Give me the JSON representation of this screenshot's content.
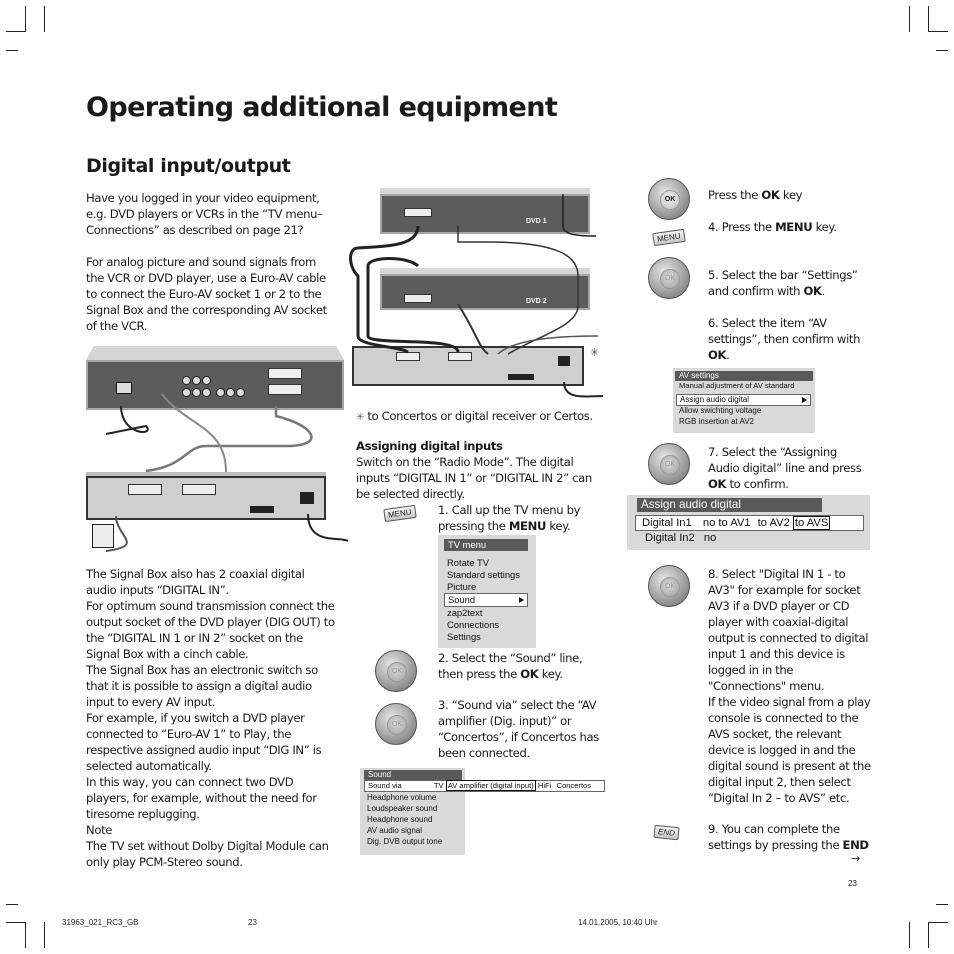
{
  "page": {
    "title": "Operating additional equipment",
    "section_title": "Digital input/output",
    "page_number": "23"
  },
  "left_column": {
    "intro_paragraph": "Have you logged in your video equipment, e.g. DVD players or VCRs in the “TV menu– Connections” as described on page 21?",
    "analog_paragraph": "For analog picture and sound signals from the VCR or DVD player, use a Euro-AV cable to connect the Euro-AV socket 1 or 2 to the Signal Box and the corresponding AV socket of the VCR.",
    "lines": [
      "The Signal Box also has 2 coaxial digital audio inputs “DIGITAL IN”.",
      "For optimum sound transmission connect the output socket of the DVD player (DIG OUT) to the “DIGITAL IN 1 or IN 2” socket on the Signal Box with a cinch cable.",
      "The Signal Box has an electronic switch so that it is possible to assign a digital audio input to every AV input.",
      "For example, if you switch a DVD player connected to “Euro-AV 1” to Play, the respective assigned audio input “DIG IN” is selected automatically.",
      "In this way, you can connect two DVD players, for example, without the need for tiresome replugging.",
      "Note",
      "The TV set without Dolby Digital Module can only play PCM-Stereo sound."
    ]
  },
  "diagram": {
    "dvd1_label": "DVD 1",
    "dvd2_label": "DVD 2",
    "asterisk": "✳",
    "footnote": "to Concertos or digital receiver or Certos."
  },
  "middle_column": {
    "heading": "Assigning digital inputs",
    "intro": "Switch on the “Radio Mode”. The digital inputs “DIGITAL IN 1” or “DIGITAL IN 2” can be selected directly.",
    "step1": {
      "pre": "1. Call up the TV menu by pressing the ",
      "key": "MENU",
      "post": " key."
    },
    "step2": {
      "pre": "2. Select the “Sound” line, then press the ",
      "key": "OK",
      "post": " key."
    },
    "step3": "3. “Sound via” select the “AV amplifier (Dig. input)” or “Concertos”, if Concertos has been connected.",
    "tv_menu": {
      "header": "TV menu",
      "items": [
        "Rotate TV",
        "Standard settings",
        "Picture",
        "Sound",
        "zap2text",
        "Connections",
        "Settings"
      ],
      "selected_index": 3
    },
    "sound_menu": {
      "header": "Sound",
      "sound_via_label": "Sound via",
      "sound_via_options": [
        "TV",
        "AV amplifier (digital input)",
        "HiFi",
        "Concertos"
      ],
      "sound_via_selected": "AV amplifier (digital input)",
      "items": [
        "Headphone volume",
        "Loudspeaker sound",
        "Headphone sound",
        "AV audio signal",
        "Dig. DVB output tone"
      ]
    }
  },
  "right_column": {
    "press_ok": {
      "pre": "Press the ",
      "key": "OK",
      "post": " key"
    },
    "step4": {
      "pre": "4. Press the ",
      "key": "MENU",
      "post": " key."
    },
    "step5": {
      "pre": "5. Select the bar “Settings” and confirm with ",
      "key": "OK",
      "post": "."
    },
    "step6": {
      "pre": "6. Select the item “AV settings”, then confirm with ",
      "key": "OK",
      "post": "."
    },
    "av_menu": {
      "header": "AV settings",
      "items": [
        "Manual adjustment of AV standard",
        "Assign audio digital",
        "Allow swichting voltage",
        "RGB insertion at AV2"
      ],
      "selected_index": 1
    },
    "step7": {
      "pre": "7. Select the “Assigning Audio digital” line and press ",
      "key": "OK",
      "post": " to confirm."
    },
    "assign_menu": {
      "header": "Assign audio digital",
      "row1_label": "Digital In1",
      "row1_options": [
        "no",
        "to AV1",
        "to AV2",
        "to AVS"
      ],
      "row1_selected": "to AVS",
      "row2_label": "Digital In2",
      "row2_value": "no"
    },
    "step8": "8. Select \"Digital IN 1 -  to AV3\" for example for socket AV3 if a DVD player or CD player with coaxial-digital output is connected to digital input 1 and this device is logged in in the \"Connections\" menu.",
    "step8b": "If the video signal from a play console is connected to the AVS socket, the relevant device is logged in and the digital sound is present at the digital input 2, then select “Digital In 2 – to AVS” etc.",
    "step9": {
      "pre": "9. You can complete the settings by pressing the ",
      "key": "END",
      "post": ""
    },
    "continue_arrow": "→"
  },
  "keys": {
    "ok": "OK",
    "menu": "MENU",
    "end": "END"
  },
  "footer": {
    "file": "31963_021_RC3_GB",
    "page": "23",
    "timestamp": "14.01.2005, 10:40 Uhr"
  }
}
